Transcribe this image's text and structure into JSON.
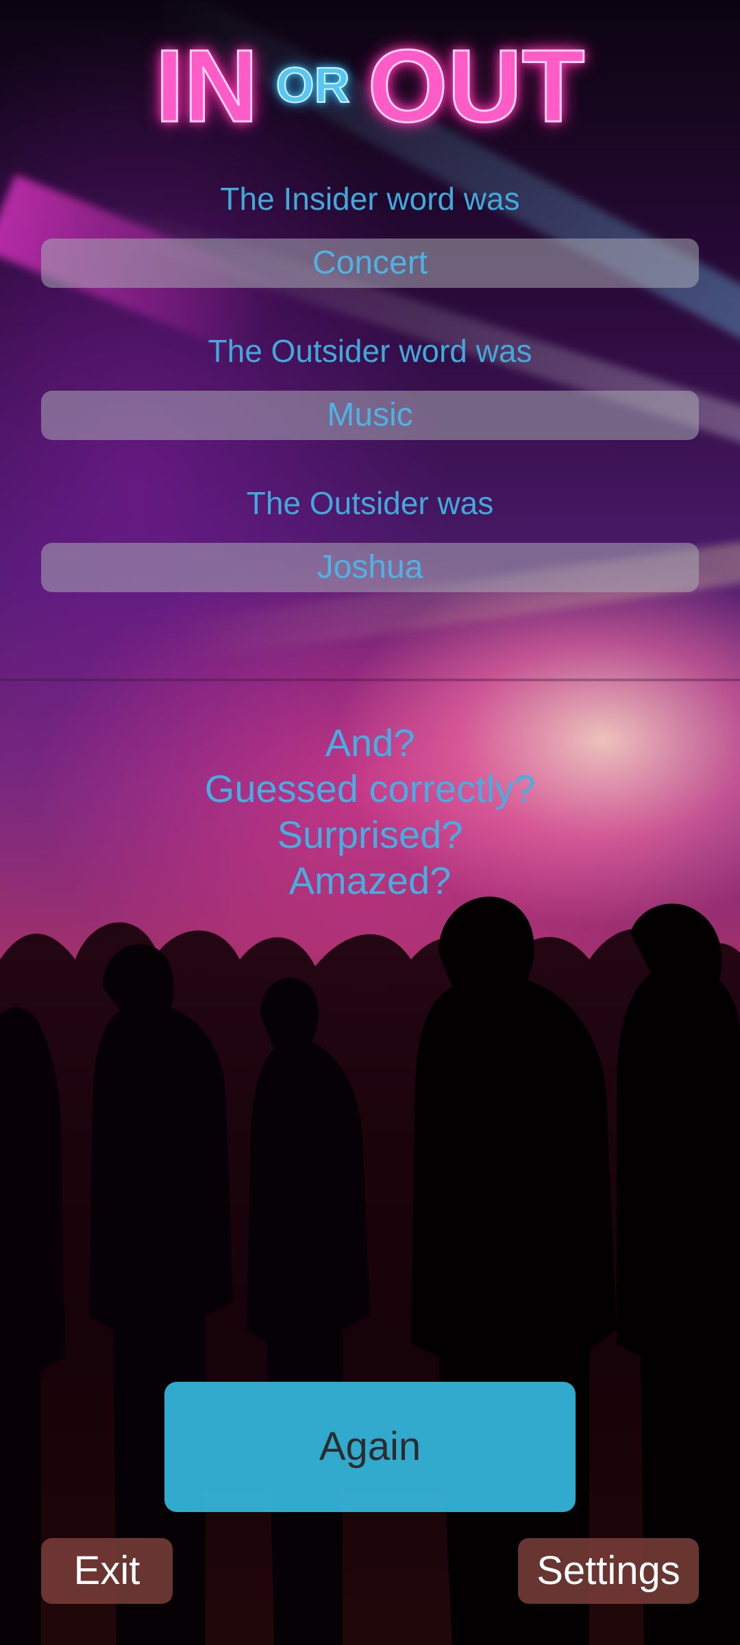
{
  "header": {
    "title_in": "IN",
    "title_or": "OR",
    "title_out": "OUT"
  },
  "results": {
    "insider_label": "The Insider word was",
    "insider_value": "Concert",
    "outsider_word_label": "The Outsider word was",
    "outsider_word_value": "Music",
    "outsider_label": "The Outsider was",
    "outsider_value": "Joshua"
  },
  "prompt": {
    "lines": [
      "And?",
      "Guessed correctly?",
      "Surprised?",
      "Amazed?"
    ]
  },
  "buttons": {
    "again": "Again",
    "exit": "Exit",
    "settings": "Settings"
  },
  "colors": {
    "title_pink": "#ff5cc8",
    "title_blue": "#56c6f5",
    "text_blue": "#42a9da",
    "again_bg": "#35b7de",
    "exit_settings_bg": "#783c37"
  }
}
